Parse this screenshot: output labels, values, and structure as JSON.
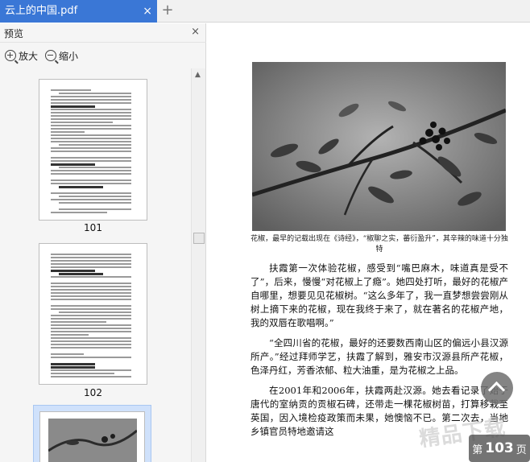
{
  "tab": {
    "title": "云上的中国.pdf",
    "close": "×",
    "new": "+"
  },
  "panel": {
    "title": "预览",
    "close": "×",
    "zoom_in": "放大",
    "zoom_out": "缩小"
  },
  "thumbnails": [
    {
      "page": "101"
    },
    {
      "page": "102"
    }
  ],
  "main": {
    "caption": "花椒，最早的记载出现在《诗经》，“椒聊之实，蕃衍盈升”，其辛辣的味道十分独特",
    "paragraphs": [
      "扶霞第一次体验花椒，感受到“嘴巴麻木，味道真是受不了”，后来，慢慢“对花椒上了瘾”。她四处打听，最好的花椒产自哪里，想要见见花椒树。“这么多年了，我一直梦想尝尝刚从树上摘下来的花椒，现在我终于来了，就在著名的花椒产地，我的双唇在歌唱啊。”",
      "“全四川省的花椒，最好的还要数西南山区的偏远小县汉源所产。”经过拜师学艺，扶霞了解到，雅安市汉源县所产花椒，色泽丹红，芳香浓郁、粒大油重，是为花椒之上品。",
      "在2001年和2006年，扶霞两赴汉源。她去看记录了始于唐代的室纳贡的贡椒石碑，还带走一棵花椒树苗，打算移栽至英国，因入境检疫政策而未果，她懊恼不已。第二次去，当地乡镇官员特地邀请这"
    ]
  },
  "page_indicator": {
    "prefix": "第",
    "number": "103",
    "suffix": "页"
  },
  "watermark": "精品下载"
}
